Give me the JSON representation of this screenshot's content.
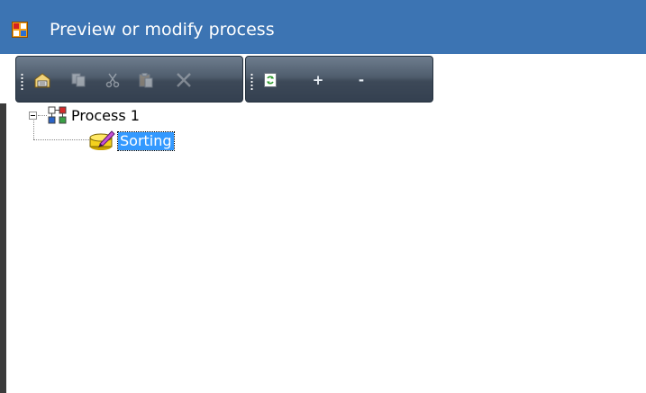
{
  "window": {
    "title": "Preview or modify process",
    "icon": "window-app-icon",
    "titlebar_color": "#3c74b3"
  },
  "toolbar": {
    "group1": [
      {
        "name": "properties-button",
        "icon": "properties-icon",
        "enabled": true
      },
      {
        "name": "copy-button",
        "icon": "copy-icon",
        "enabled": false
      },
      {
        "name": "cut-button",
        "icon": "cut-icon",
        "enabled": false
      },
      {
        "name": "paste-button",
        "icon": "paste-icon",
        "enabled": false
      },
      {
        "name": "delete-button",
        "icon": "delete-icon",
        "enabled": false
      }
    ],
    "group2": [
      {
        "name": "refresh-button",
        "icon": "refresh-icon",
        "enabled": true
      },
      {
        "name": "expand-button",
        "label": "+"
      },
      {
        "name": "collapse-button",
        "label": "-"
      }
    ]
  },
  "tree": {
    "root": {
      "label": "Process 1",
      "expanded": true,
      "icon": "process-network-icon"
    },
    "children": [
      {
        "label": "Sorting",
        "selected": true,
        "icon": "sorting-step-icon"
      }
    ],
    "selection_color": "#3399ff"
  }
}
